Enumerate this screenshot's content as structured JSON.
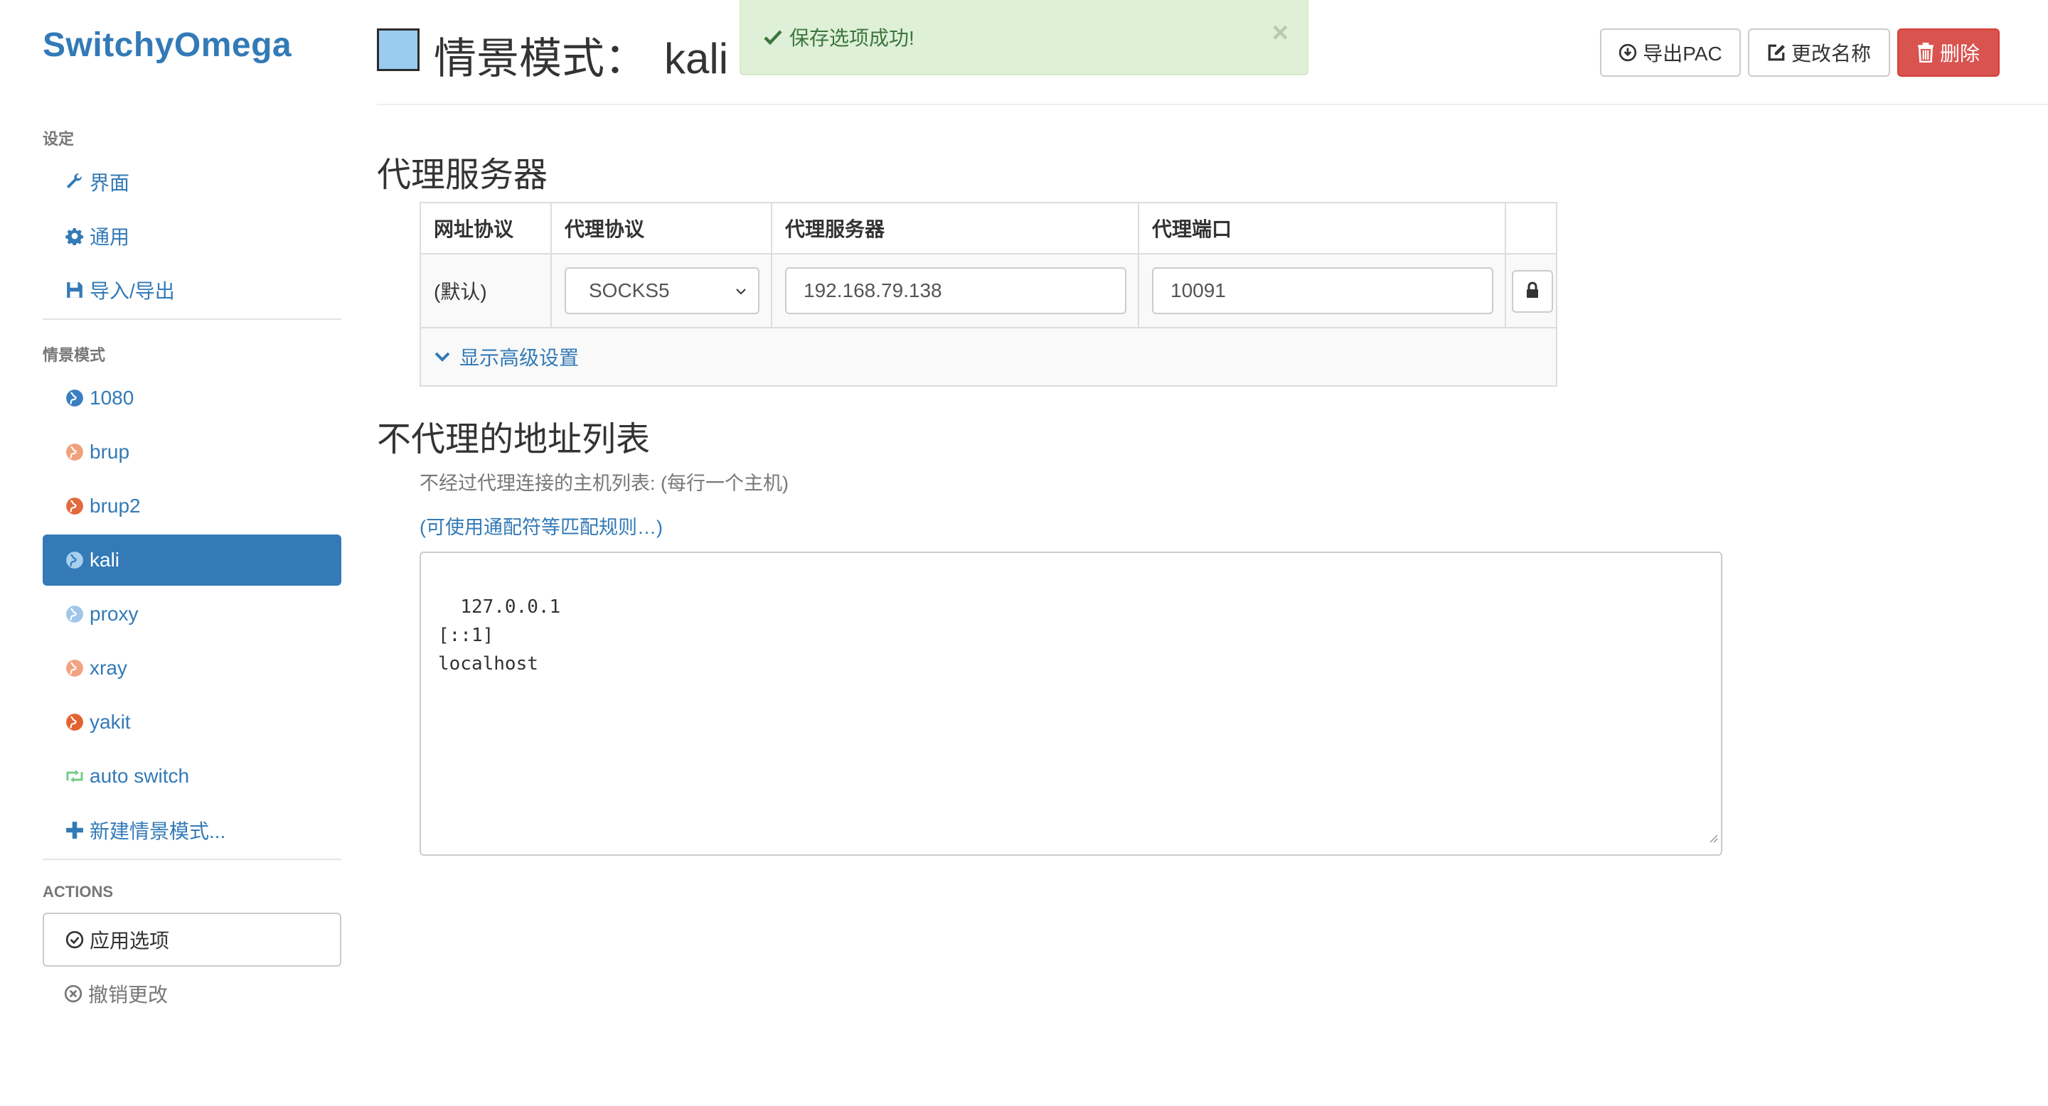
{
  "app": {
    "brand": "SwitchyOmega"
  },
  "sidebar": {
    "settings_header": "设定",
    "settings_items": [
      {
        "label": "界面",
        "icon": "wrench-icon"
      },
      {
        "label": "通用",
        "icon": "gear-icon"
      },
      {
        "label": "导入/导出",
        "icon": "floppy-icon"
      }
    ],
    "profiles_header": "情景模式",
    "profiles": [
      {
        "label": "1080",
        "icon": "globe-icon",
        "color": "#3a7fc4"
      },
      {
        "label": "brup",
        "icon": "globe-icon",
        "color": "#f0a07a"
      },
      {
        "label": "brup2",
        "icon": "globe-icon",
        "color": "#e26a3c"
      },
      {
        "label": "kali",
        "icon": "globe-icon",
        "color": "#a8d0ee",
        "active": true
      },
      {
        "label": "proxy",
        "icon": "globe-icon",
        "color": "#9fc6ea"
      },
      {
        "label": "xray",
        "icon": "globe-icon",
        "color": "#f2a27f"
      },
      {
        "label": "yakit",
        "icon": "globe-icon",
        "color": "#e5622e"
      },
      {
        "label": "auto switch",
        "icon": "retweet-icon",
        "color": "#77cc88"
      },
      {
        "label": "新建情景模式...",
        "icon": "plus-icon",
        "color": "#337ab7"
      }
    ],
    "actions_header": "ACTIONS",
    "apply_label": "应用选项",
    "discard_label": "撤销更改"
  },
  "header": {
    "title_prefix": "情景模式：",
    "profile_name": "kali",
    "swatch_color": "#99ccee",
    "alert_text": "保存选项成功!",
    "alert_close": "×",
    "export_pac": "导出PAC",
    "rename": "更改名称",
    "delete": "删除"
  },
  "proxy": {
    "section_title": "代理服务器",
    "columns": [
      "网址协议",
      "代理协议",
      "代理服务器",
      "代理端口"
    ],
    "row": {
      "scheme": "(默认)",
      "protocol": "SOCKS5",
      "server": "192.168.79.138",
      "port": "10091"
    },
    "advanced_label": "显示高级设置"
  },
  "bypass": {
    "section_title": "不代理的地址列表",
    "help": "不经过代理连接的主机列表: (每行一个主机)",
    "wildcard_link": "(可使用通配符等匹配规则…)",
    "list": "127.0.0.1\n[::1]\nlocalhost"
  },
  "colors": {
    "accent": "#337ab7",
    "danger": "#d9534f",
    "success_bg": "#dff0d8",
    "success_text": "#3c763d"
  }
}
